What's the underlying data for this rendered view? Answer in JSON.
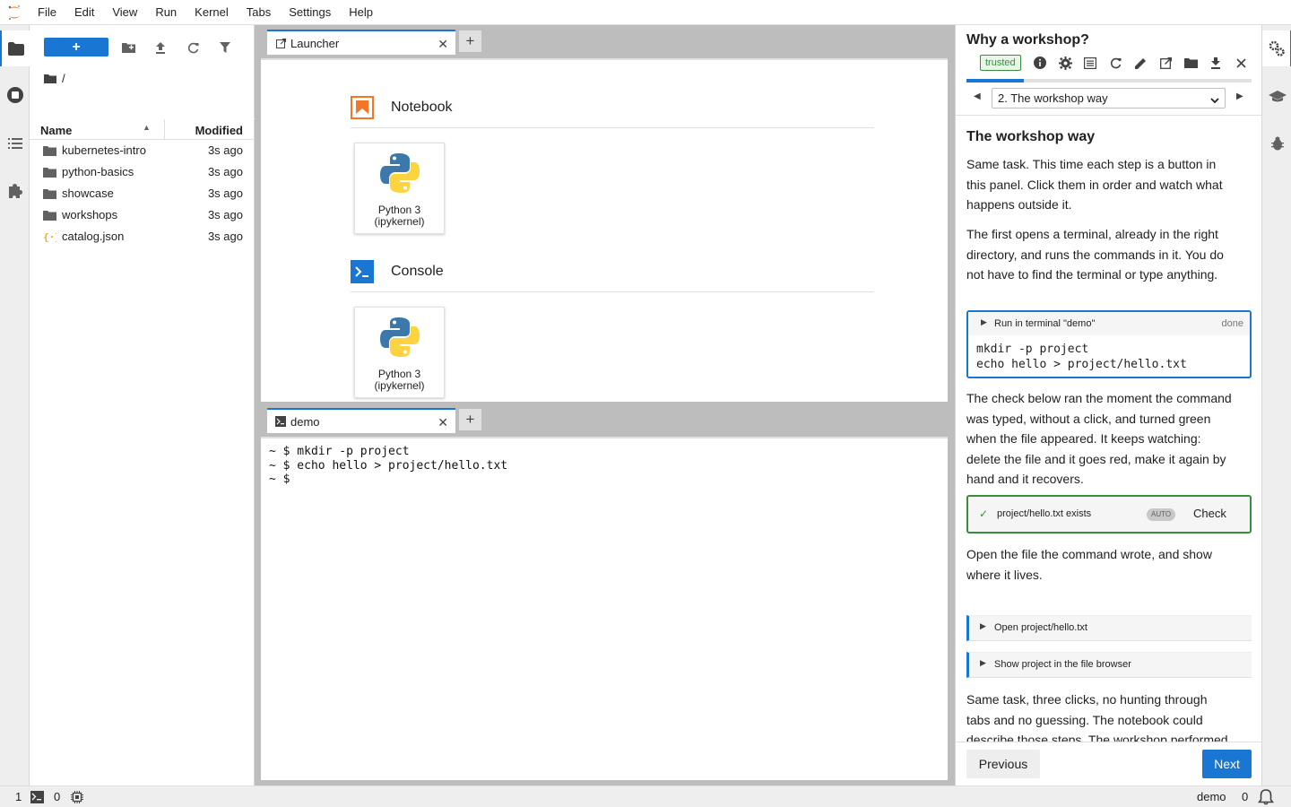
{
  "menubar": {
    "items": [
      "File",
      "Edit",
      "View",
      "Run",
      "Kernel",
      "Tabs",
      "Settings",
      "Help"
    ]
  },
  "filebrowser": {
    "new_label": "+",
    "breadcrumb": "/",
    "columns": {
      "name": "Name",
      "modified": "Modified"
    },
    "items": [
      {
        "name": "kubernetes-intro",
        "modified": "3s ago",
        "type": "folder"
      },
      {
        "name": "python-basics",
        "modified": "3s ago",
        "type": "folder"
      },
      {
        "name": "showcase",
        "modified": "3s ago",
        "type": "folder"
      },
      {
        "name": "workshops",
        "modified": "3s ago",
        "type": "folder"
      },
      {
        "name": "catalog.json",
        "modified": "3s ago",
        "type": "json"
      }
    ]
  },
  "launcher": {
    "tab_label": "Launcher",
    "close": "✕",
    "add": "+",
    "sections": [
      {
        "title": "Notebook",
        "kernel_label_1": "Python 3",
        "kernel_label_2": "(ipykernel)"
      },
      {
        "title": "Console",
        "kernel_label_1": "Python 3",
        "kernel_label_2": "(ipykernel)"
      }
    ]
  },
  "terminal": {
    "tab_label": "demo",
    "close": "✕",
    "add": "+",
    "lines": [
      "~ $ mkdir -p project",
      "~ $ echo hello > project/hello.txt",
      "~ $"
    ]
  },
  "workshop": {
    "title": "Why a workshop?",
    "trusted": "trusted",
    "progress_fraction": 0.2,
    "step_select": "2. The workshop way",
    "heading": "The workshop way",
    "p1": "Same task. This time each step is a button in this panel. Click them in order and watch what happens outside it.",
    "p2": "The first opens a terminal, already in the right directory, and runs the commands in it. You do not have to find the terminal or type anything.",
    "run_block": {
      "label": "Run in terminal \"demo\"",
      "status": "done",
      "code_line_1": "mkdir -p project",
      "code_line_2": "echo hello > project/hello.txt"
    },
    "p3": "The check below ran the moment the command was typed, without a click, and turned green when the file appeared. It keeps watching: delete the file and it goes red, make it again by hand and it recovers.",
    "check_block": {
      "mark": "✓",
      "label": "project/hello.txt exists",
      "badge": "AUTO",
      "button": "Check"
    },
    "p4": "Open the file the command wrote, and show where it lives.",
    "action_1": "Open project/hello.txt",
    "action_2": "Show project in the file browser",
    "p5": "Same task, three clicks, no hunting through tabs and no guessing. The notebook could describe those steps. The workshop performed them, and knows whether they",
    "btn_previous": "Previous",
    "btn_next": "Next"
  },
  "statusbar": {
    "terminals_count": "1",
    "kernels_count": "0",
    "active_name": "demo",
    "notifications_count": "0"
  },
  "colors": {
    "accent": "#1976d2",
    "success": "#388e3c",
    "brand_orange": "#f37626"
  }
}
